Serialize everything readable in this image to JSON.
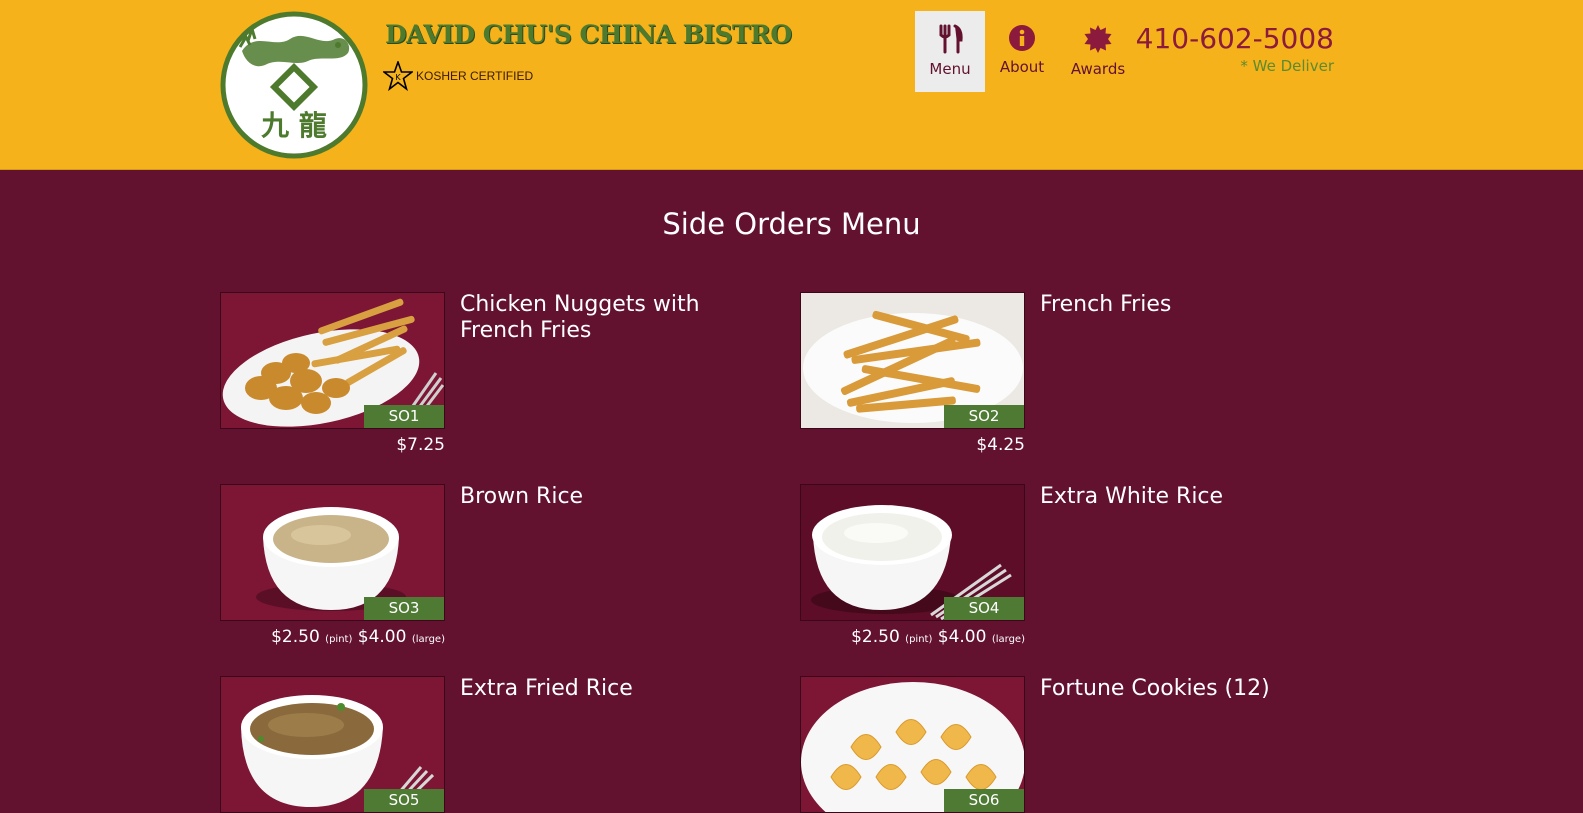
{
  "header": {
    "brand": "DAVID CHU'S CHINA BISTRO",
    "kosher": "KOSHER CERTIFIED",
    "phone": "410-602-5008",
    "deliver": "* We Deliver",
    "logo_chars": "九 龍",
    "nav": [
      {
        "label": "Menu",
        "icon": "utensils-icon",
        "active": true
      },
      {
        "label": "About",
        "icon": "info-icon",
        "active": false
      },
      {
        "label": "Awards",
        "icon": "award-badge-icon",
        "active": false
      }
    ]
  },
  "colors": {
    "header_bg": "#f5b21a",
    "page_bg": "#62112f",
    "brand_green": "#4e7a2e",
    "code_badge": "#4f7a34",
    "phone": "#8b1a3c"
  },
  "section_title": "Side Orders Menu",
  "items": [
    {
      "name": "Chicken Nuggets with French Fries",
      "code": "SO1",
      "price": "$7.25",
      "photo": "chicken-nuggets-fries"
    },
    {
      "name": "French Fries",
      "code": "SO2",
      "price": "$4.25",
      "photo": "french-fries"
    },
    {
      "name": "Brown Rice",
      "code": "SO3",
      "price_pint": "$2.50",
      "price_pint_label": "(pint)",
      "price_large": "$4.00",
      "price_large_label": "(large)",
      "photo": "brown-rice"
    },
    {
      "name": "Extra White Rice",
      "code": "SO4",
      "price_pint": "$2.50",
      "price_pint_label": "(pint)",
      "price_large": "$4.00",
      "price_large_label": "(large)",
      "photo": "white-rice"
    },
    {
      "name": "Extra Fried Rice",
      "code": "SO5",
      "photo": "fried-rice"
    },
    {
      "name": "Fortune Cookies (12)",
      "code": "SO6",
      "photo": "fortune-cookies"
    }
  ]
}
